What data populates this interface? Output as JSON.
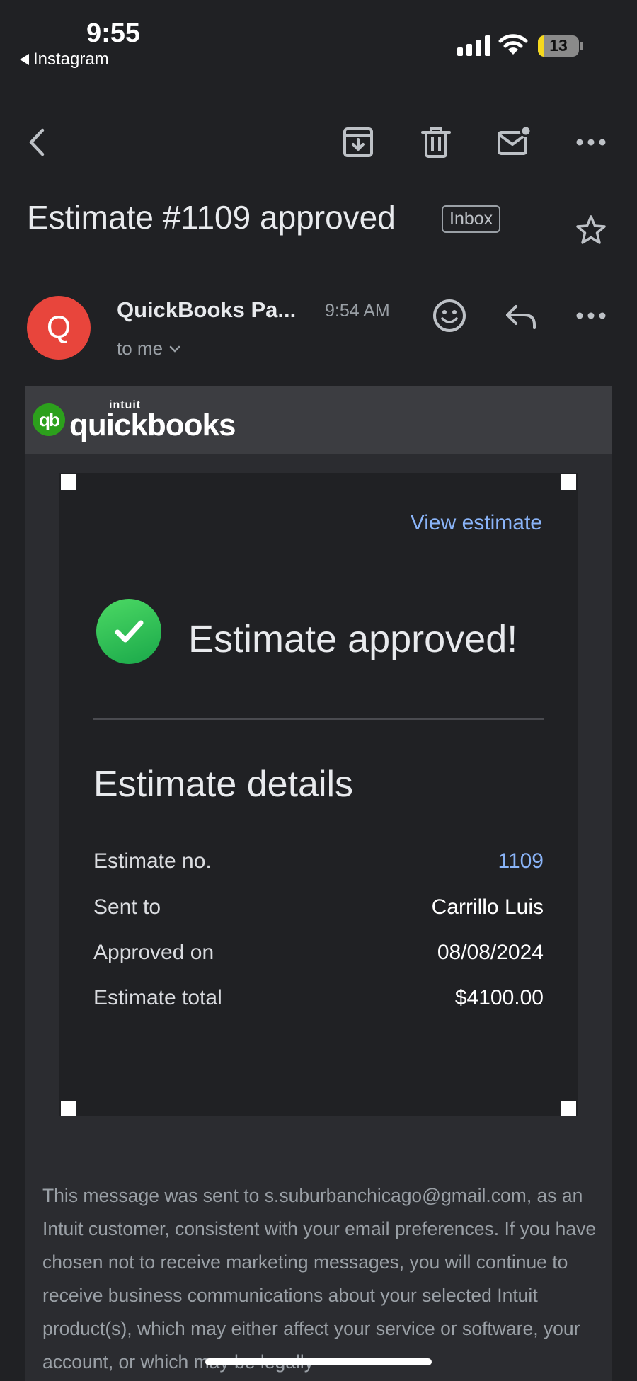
{
  "status_bar": {
    "time": "9:55",
    "back_app": "Instagram",
    "battery_level": "13",
    "battery_fraction": 0.13
  },
  "toolbar": {
    "back_icon": "chevron-left-icon",
    "archive_icon": "archive-icon",
    "delete_icon": "trash-icon",
    "mark_unread_icon": "mail-unread-icon",
    "more_icon": "more-horizontal-icon"
  },
  "email": {
    "subject": "Estimate #1109 approved",
    "label": "Inbox",
    "sender_initial": "Q",
    "sender_name": "QuickBooks Pa...",
    "time": "9:54 AM",
    "recipient": "to me"
  },
  "body": {
    "brand_small": "intuit",
    "brand": "quickbooks",
    "brand_mark": "qb",
    "view_estimate": "View estimate",
    "approved_title": "Estimate approved!",
    "details_title": "Estimate details",
    "details": [
      {
        "label": "Estimate no.",
        "value": "1109"
      },
      {
        "label": "Sent to",
        "value": "Carrillo Luis"
      },
      {
        "label": "Approved on",
        "value": "08/08/2024"
      },
      {
        "label": "Estimate total",
        "value": "$4100.00"
      }
    ],
    "disclaimer": "This message was sent to s.suburbanchicago@gmail.com, as an Intuit customer, consistent with your email preferences. If you have chosen not to receive marketing messages, you will continue to receive business communications about your selected Intuit product(s), which may either affect your service or software, your account, or which may be legally"
  },
  "colors": {
    "background": "#202124",
    "link": "#8ab4f8",
    "avatar": "#e8453c",
    "quickbooks_green": "#2ca01c",
    "success_green": "#34c759",
    "battery": "#f5d81e"
  }
}
